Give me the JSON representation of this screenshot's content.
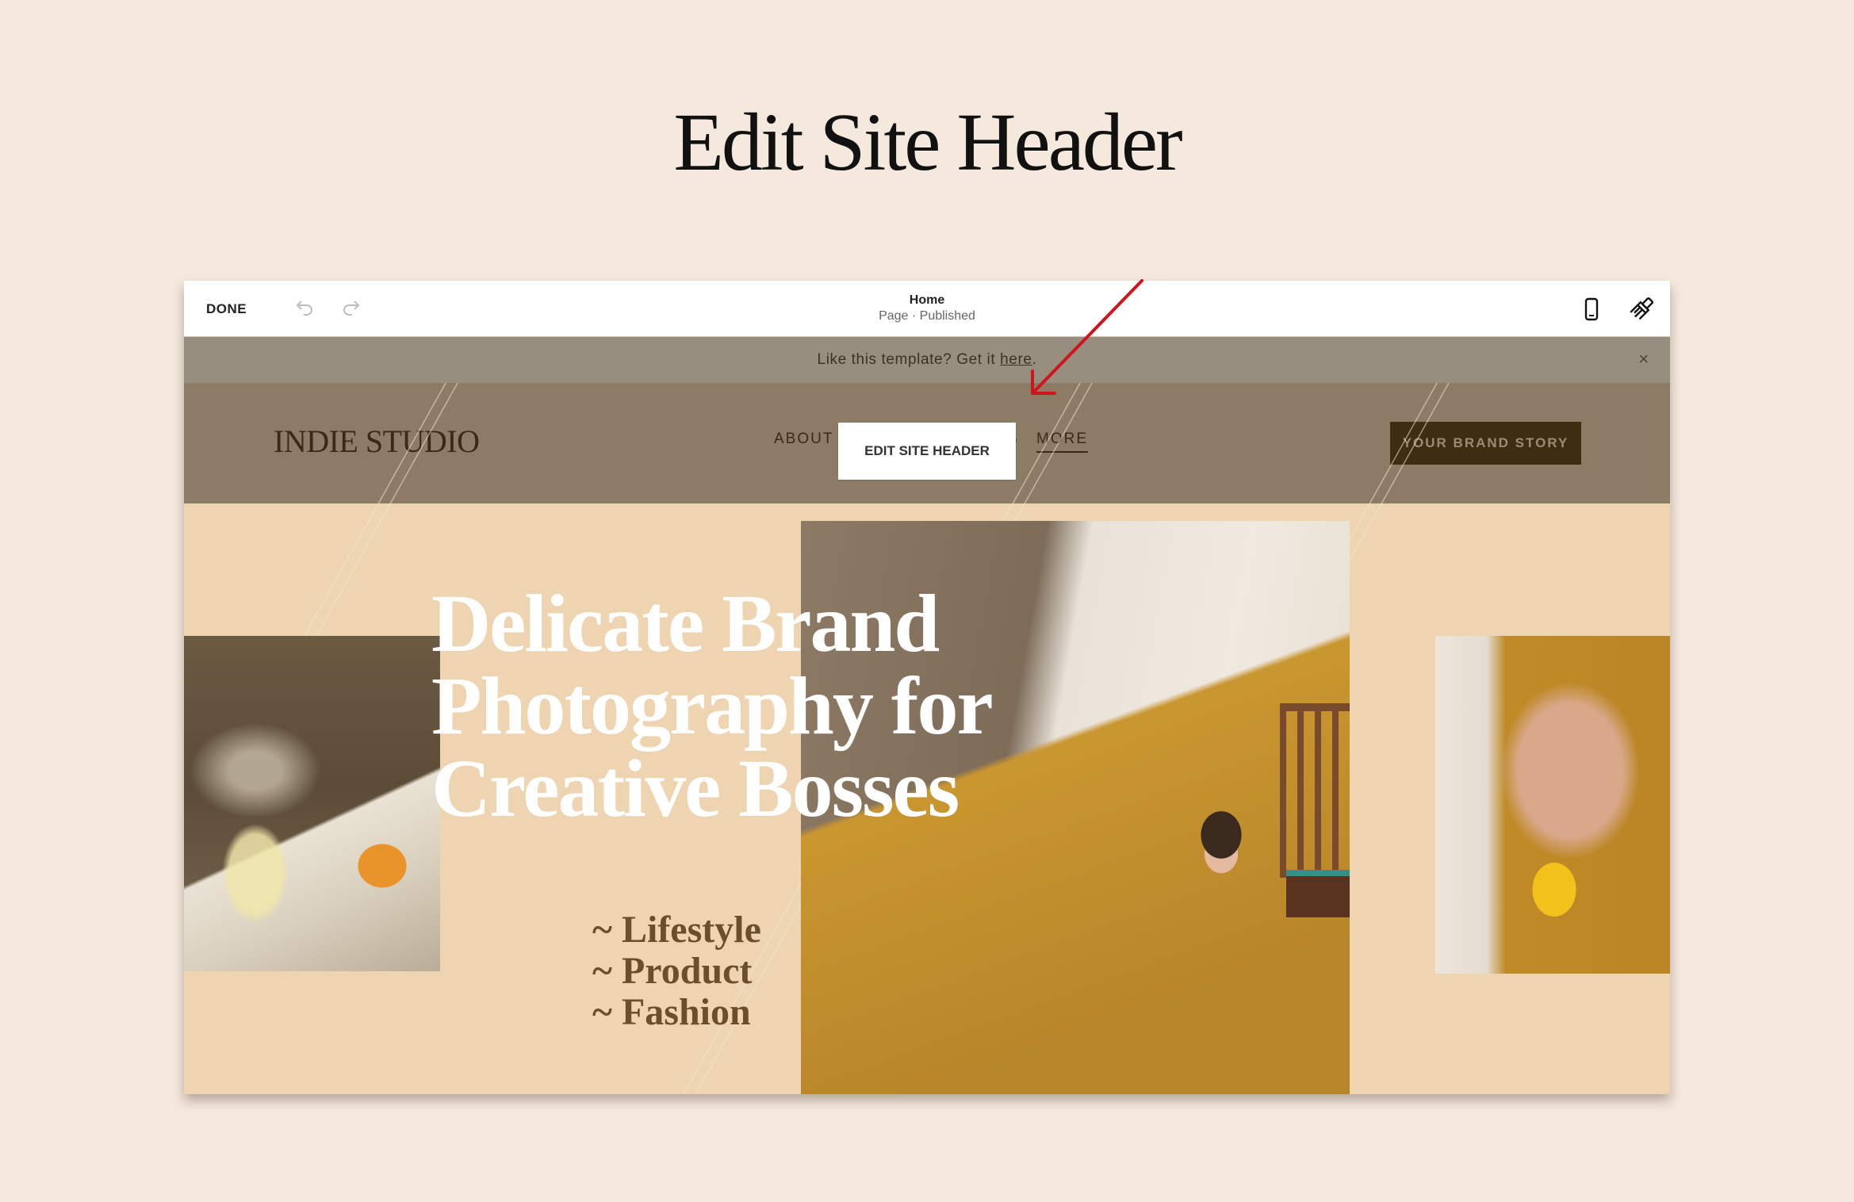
{
  "page_title": "Edit Site Header",
  "toolbar": {
    "done_label": "DONE",
    "undo_icon": "undo-icon",
    "redo_icon": "redo-icon",
    "page_name": "Home",
    "page_status": "Page · Published",
    "mobile_icon": "mobile-preview-icon",
    "design_icon": "paintbrush-icon"
  },
  "announcement": {
    "text": "Like this template? Get it ",
    "link_text": "here",
    "suffix": ".",
    "close_icon": "close-icon",
    "close_glyph": "×"
  },
  "site_header": {
    "logo": "INDIE STUDIO",
    "nav": [
      {
        "label": "ABOUT"
      },
      {
        "label": "S"
      },
      {
        "label": "MORE"
      }
    ],
    "edit_button": "EDIT SITE HEADER",
    "cta_button": "YOUR BRAND STORY"
  },
  "hero": {
    "headline_lines": [
      "Delicate Brand",
      "Photography for",
      "Creative Bosses"
    ],
    "taglines": [
      "~ Lifestyle",
      "~ Product",
      "~ Fashion"
    ]
  },
  "colors": {
    "page_bg": "#f5e9de",
    "announce_bg": "#978e7f",
    "header_bg": "#8c7c66",
    "hero_bg": "#eed4b0",
    "cta_bg": "#3f2d12",
    "tagline": "#6b4f2a",
    "arrow": "#d0141c"
  }
}
